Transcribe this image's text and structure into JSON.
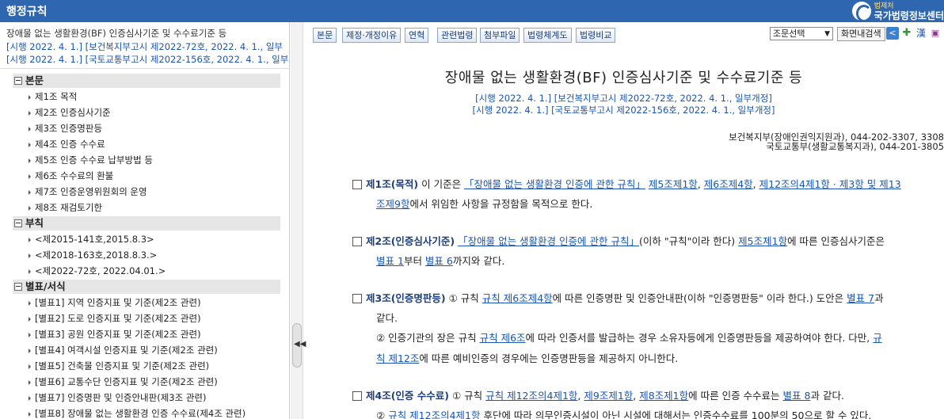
{
  "header": {
    "title": "행정규칙",
    "brand_small": "법제처",
    "brand_big": "국가법령정보센터"
  },
  "sidebar": {
    "doc_title": "장애물 없는 생활환경(BF) 인증심사기준 및 수수료기준 등",
    "revision_1": "[시행 2022. 4. 1.] [보건복지부고시 제2022-72호, 2022. 4. 1., 일부",
    "revision_2": "[시행 2022. 4. 1.] [국토교통부고시 제2022-156호, 2022. 4. 1., 일부",
    "sections": [
      {
        "label": "본문",
        "items": [
          "제1조 목적",
          "제2조 인증심사기준",
          "제3조 인증명판등",
          "제4조 인증 수수료",
          "제5조 인증 수수료 납부방법 등",
          "제6조 수수료의 환불",
          "제7조 인증운영위원회의 운영",
          "제8조 재검토기한"
        ]
      },
      {
        "label": "부칙",
        "items": [
          "<제2015-141호,2015.8.3>",
          "<제2018-163호,2018.8.3.>",
          "<제2022-72호, 2022.04.01.>"
        ]
      },
      {
        "label": "별표/서식",
        "items": [
          "[별표1] 지역 인증지표 및 기준(제2조 관련)",
          "[별표2] 도로 인증지표 및 기준(제2조 관련)",
          "[별표3] 공원 인증지표 및 기준(제2조 관련)",
          "[별표4] 여객시설 인증지표 및 기준(제2조 관련)",
          "[별표5] 건축물 인증지표 및 기준(제2조 관련)",
          "[별표6] 교통수단 인증지표 및 기준(제2조 관련)",
          "[별표7] 인증명판 및 인증안내판(제3조 관련)",
          "[별표8] 장애물 없는 생활환경 인증 수수료(제4조 관련)"
        ]
      }
    ]
  },
  "toolbar": {
    "buttons": [
      "본문",
      "제정·개정이유",
      "연혁",
      "관련법령",
      "첨부파일",
      "법령체계도",
      "법령비교"
    ],
    "select_value": "조문선택",
    "search_button": "화면내검색",
    "icons": [
      "share-icon",
      "bookmark-icon",
      "hanja-icon",
      "save-icon"
    ]
  },
  "doc": {
    "title": "장애물 없는 생활환경(BF) 인증심사기준 및 수수료기준 등",
    "revision_1": "[시행 2022. 4. 1.] [보건복지부고시 제2022-72호, 2022. 4. 1., 일부개정]",
    "revision_2": "[시행 2022. 4. 1.] [국토교통부고시 제2022-156호, 2022. 4. 1., 일부개정]",
    "dept_1": "보건복지부(장애인권익지원과), 044-202-3307, 3308",
    "dept_2": "국토교통부(생활교통복지과), 044-201-3805",
    "art1": {
      "head": "제1조(목적)",
      "t1": " 이 기준은 ",
      "l1": "「장애물 없는 생활환경 인증에 관한 규칙」",
      "t2": " ",
      "l2": "제5조제1항",
      "t3": ", ",
      "l3": "제6조제4항",
      "t4": ", ",
      "l4": "제12조의4제1항 · 제3항 및 제13",
      "c1": "조제9항",
      "c2": "에서 위임한 사항을 규정함을 목적으로 한다."
    },
    "art2": {
      "head": "제2조(인증심사기준)",
      "t1": " ",
      "l1": "「장애물 없는 생활환경 인증에 관한 규칙」",
      "t2": "(이하 \"규칙\"이라 한다) ",
      "l2": "제5조제1항",
      "t3": "에 따른 인증심사기준은",
      "c1": "별표 1",
      "c2": "부터 ",
      "c3": "별표 6",
      "c4": "까지와 같다."
    },
    "art3": {
      "head": "제3조(인증명판등)",
      "t1": " ① 규칙 ",
      "l1": "규칙 제6조제4항",
      "t2": "에 따른 인증명판 및 인증안내판(이하 \"인증명판등\" 이라 한다.) 도안은 ",
      "l2": "별표 7",
      "t3": "과",
      "c1": "같다.",
      "p2a": "② 인증기관의 장은 규칙 ",
      "p2l": "규칙 제6조",
      "p2b": "에 따라 인증서를 발급하는 경우 소유자등에게 인증명판등을 제공하여야 한다. 다만, ",
      "p2l2": "규",
      "c2l": "칙 제12조",
      "c2b": "에 따른 예비인증의 경우에는 인증명판등을 제공하지 아니한다."
    },
    "art4": {
      "head": "제4조(인증 수수료)",
      "t1": " ① 규칙 ",
      "l1": "규칙 제12조의4제1항",
      "t2": ", ",
      "l2": "제9조제1항",
      "t3": ", ",
      "l3": "제8조제1항",
      "t4": "에 따른 인증 수수료는 ",
      "l4": "별표 8",
      "t5": "과 같다.",
      "p2a": "② ",
      "p2l": "규칙 제12조의4제1항",
      "p2b": " 후단에 따라 의무인증시설이 아닌 시설에 대해서는 인증수수료를 100분의 50으로 할 수 있다."
    }
  }
}
